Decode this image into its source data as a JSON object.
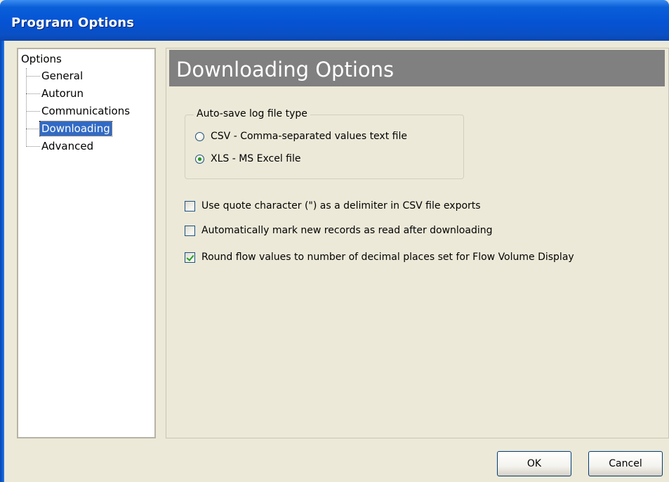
{
  "window": {
    "title": "Program Options"
  },
  "tree": {
    "root_label": "Options",
    "items": [
      {
        "label": "General",
        "selected": false
      },
      {
        "label": "Autorun",
        "selected": false
      },
      {
        "label": "Communications",
        "selected": false
      },
      {
        "label": "Downloading",
        "selected": true
      },
      {
        "label": "Advanced",
        "selected": false
      }
    ]
  },
  "content": {
    "header_title": "Downloading Options",
    "autosave_group": {
      "legend": "Auto-save log file type",
      "options": [
        {
          "label": "CSV - Comma-separated values text file",
          "checked": false
        },
        {
          "label": "XLS - MS Excel file",
          "checked": true
        }
      ]
    },
    "checkboxes": [
      {
        "label": "Use quote character (\") as a delimiter in CSV file exports",
        "checked": false
      },
      {
        "label": "Automatically mark new records as read after downloading",
        "checked": false
      },
      {
        "label": "Round flow values to number of decimal places set for Flow Volume Display",
        "checked": true
      }
    ]
  },
  "buttons": {
    "ok_label": "OK",
    "cancel_label": "Cancel"
  },
  "colors": {
    "titlebar": "#0553d4",
    "header_band": "#808080",
    "selection": "#316ac5",
    "window_bg": "#ece9d8"
  }
}
